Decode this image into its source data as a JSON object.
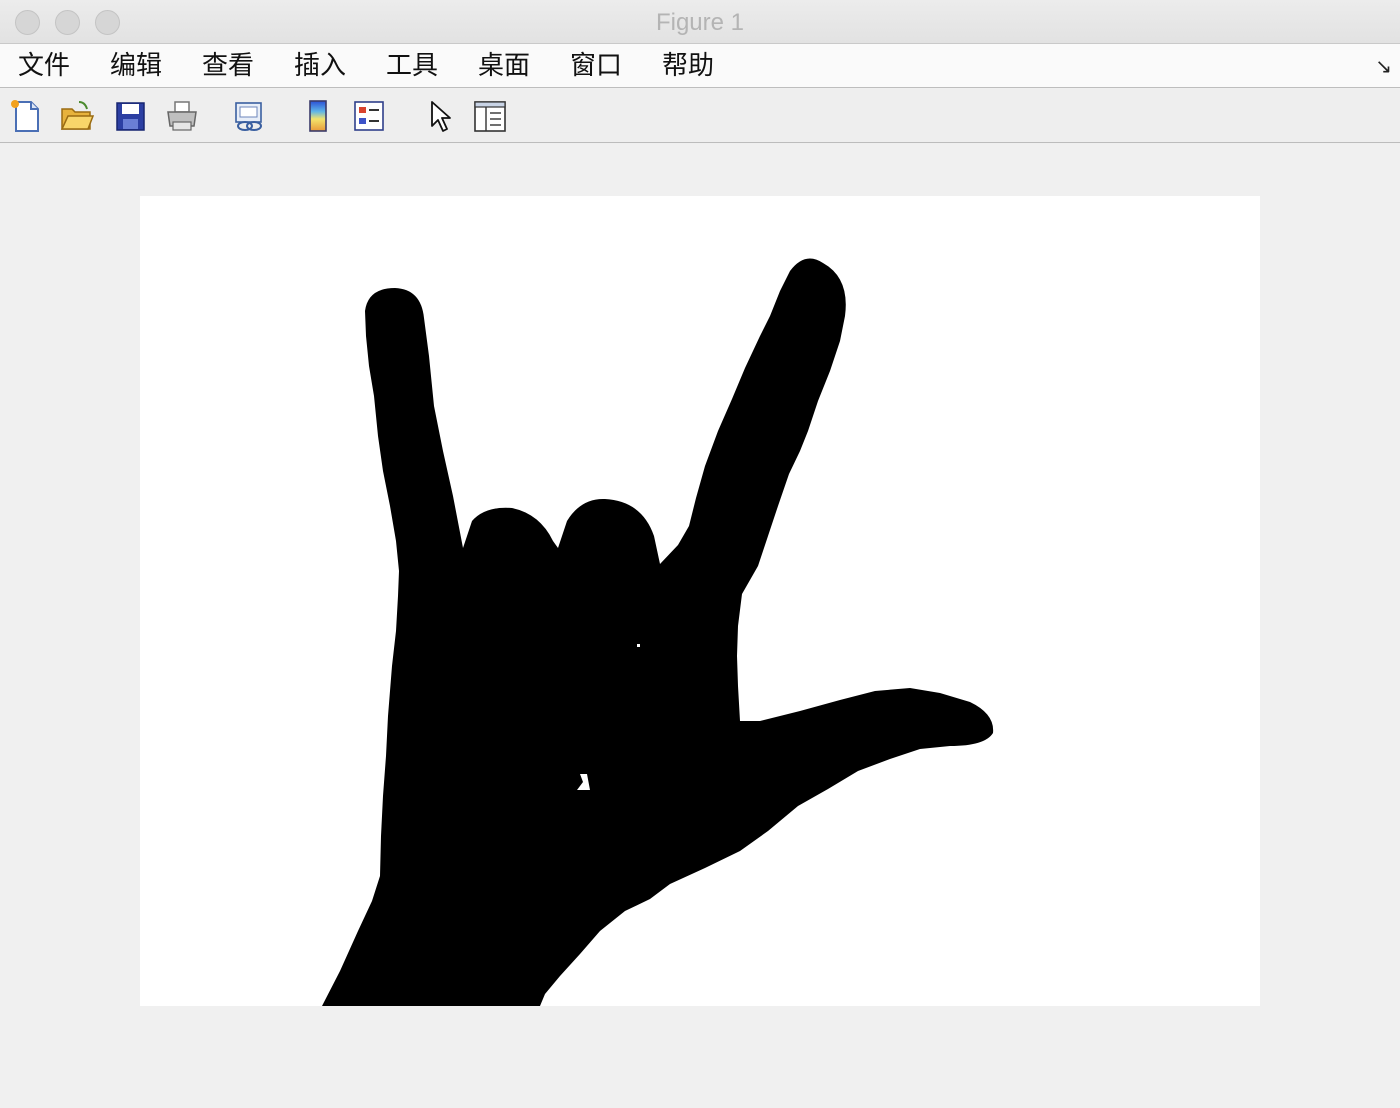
{
  "window": {
    "title": "Figure 1"
  },
  "menubar": {
    "items": [
      {
        "label": "文件"
      },
      {
        "label": "编辑"
      },
      {
        "label": "查看"
      },
      {
        "label": "插入"
      },
      {
        "label": "工具"
      },
      {
        "label": "桌面"
      },
      {
        "label": "窗口"
      },
      {
        "label": "帮助"
      }
    ],
    "overflow_icon": "chevron-overflow-icon"
  },
  "toolbar": {
    "buttons": [
      {
        "icon": "new-figure-icon"
      },
      {
        "icon": "open-file-icon"
      },
      {
        "icon": "save-icon"
      },
      {
        "icon": "print-icon"
      },
      {
        "icon": "link-plot-icon"
      },
      {
        "icon": "colorbar-icon"
      },
      {
        "icon": "legend-icon"
      },
      {
        "icon": "pointer-icon"
      },
      {
        "icon": "property-inspector-icon"
      }
    ]
  },
  "figure": {
    "image": "binary-hand-silhouette",
    "foreground_color": "#000000",
    "background_color": "#ffffff"
  }
}
